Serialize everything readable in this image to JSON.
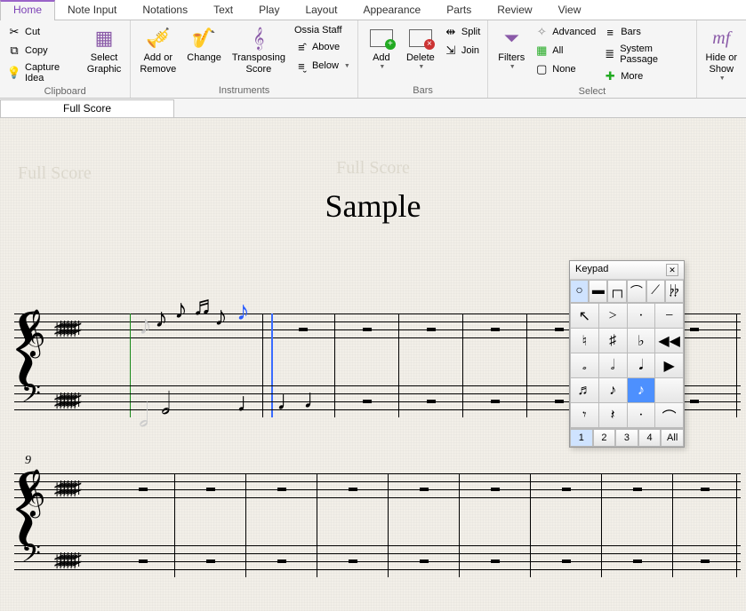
{
  "tabs": [
    "Home",
    "Note Input",
    "Notations",
    "Text",
    "Play",
    "Layout",
    "Appearance",
    "Parts",
    "Review",
    "View"
  ],
  "active_tab": "Home",
  "ribbon": {
    "clipboard": {
      "label": "Clipboard",
      "cut": "Cut",
      "copy": "Copy",
      "capture": "Capture Idea",
      "select_graphic": "Select\nGraphic"
    },
    "instruments": {
      "label": "Instruments",
      "add_remove": "Add or\nRemove",
      "change": "Change",
      "transposing": "Transposing\nScore",
      "ossia": "Ossia Staff",
      "above": "Above",
      "below": "Below"
    },
    "bars": {
      "label": "Bars",
      "add": "Add",
      "delete": "Delete",
      "split": "Split",
      "join": "Join"
    },
    "select": {
      "label": "Select",
      "filters": "Filters",
      "advanced": "Advanced",
      "all": "All",
      "none": "None",
      "bars": "Bars",
      "system_passage": "System Passage",
      "more": "More"
    },
    "hide": {
      "hide_or_show": "Hide or\nShow"
    }
  },
  "doc_tab": "Full Score",
  "score": {
    "header_ghost": "Full Score",
    "title": "Sample",
    "system2_measure_num": "9"
  },
  "keypad": {
    "title": "Keypad",
    "top_tabs": [
      "○",
      "▬",
      "┌┐",
      "⌒",
      "⟋",
      "𝄭𝄭"
    ],
    "active_top_tab": 0,
    "cells": [
      "↖",
      ">",
      "·",
      "−",
      "♮",
      "♯",
      "♭",
      "◀◀",
      "𝅗",
      "𝅗𝅥",
      "𝅘𝅥",
      "▶",
      "♬",
      "♪",
      "♪",
      "",
      "𝄾",
      "𝄽",
      "·",
      "⌒"
    ],
    "active_cell": 14,
    "pages": [
      "1",
      "2",
      "3",
      "4",
      "All"
    ],
    "active_page": 0
  }
}
